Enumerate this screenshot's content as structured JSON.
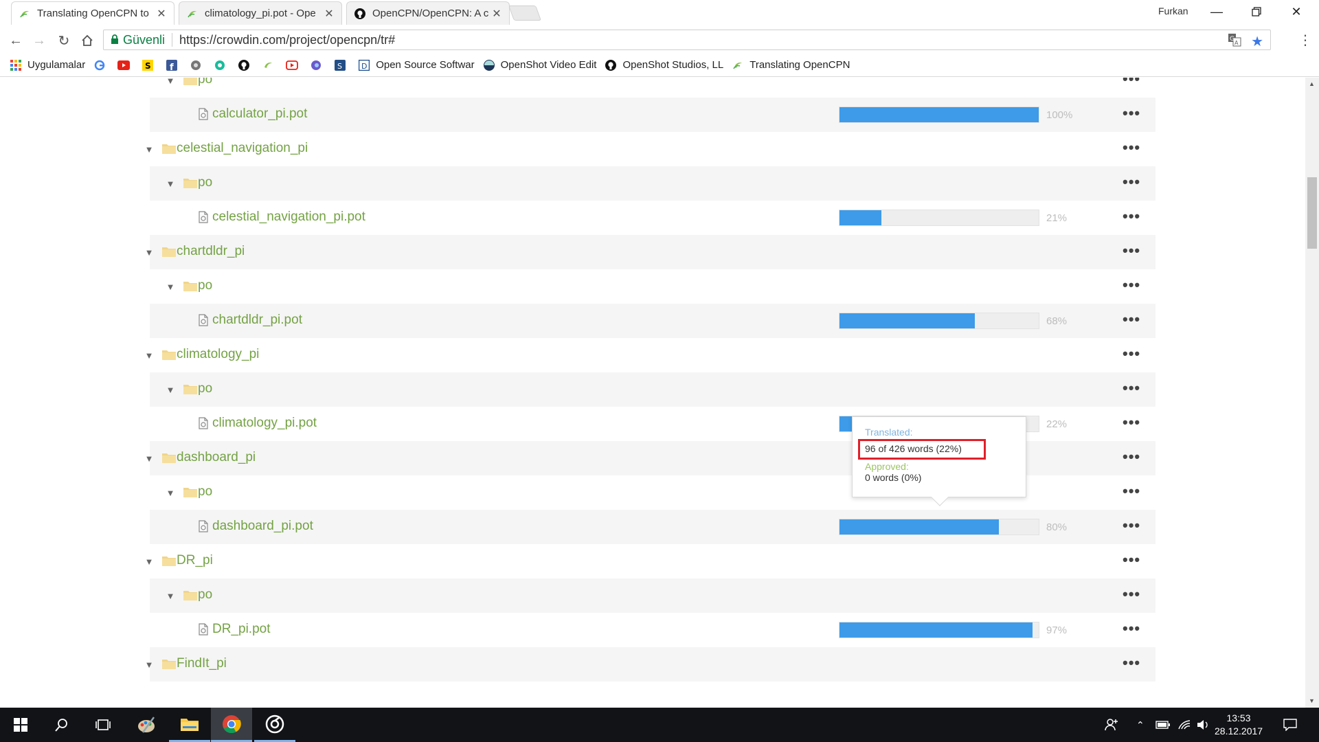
{
  "browser": {
    "tabs": [
      {
        "label": "Translating OpenCPN to",
        "active": true
      },
      {
        "label": "climatology_pi.pot - Ope",
        "active": false
      },
      {
        "label": "OpenCPN/OpenCPN: A c",
        "active": false
      }
    ],
    "user": "Furkan",
    "secure_label": "Güvenli",
    "url": "https://crowdin.com/project/opencpn/tr#"
  },
  "bookmarks": {
    "apps_label": "Uygulamalar",
    "labeled": [
      {
        "label": "Open Source Softwar"
      },
      {
        "label": "OpenShot Video Edit"
      },
      {
        "label": "OpenShot Studios, LL"
      },
      {
        "label": "Translating OpenCPN"
      }
    ]
  },
  "tree": [
    {
      "type": "subfolder",
      "name": "po"
    },
    {
      "type": "file",
      "name": "calculator_pi.pot",
      "progress": 100,
      "pct": "100%"
    },
    {
      "type": "folder",
      "name": "celestial_navigation_pi"
    },
    {
      "type": "subfolder",
      "name": "po"
    },
    {
      "type": "file",
      "name": "celestial_navigation_pi.pot",
      "progress": 21,
      "pct": "21%"
    },
    {
      "type": "folder",
      "name": "chartdldr_pi"
    },
    {
      "type": "subfolder",
      "name": "po"
    },
    {
      "type": "file",
      "name": "chartdldr_pi.pot",
      "progress": 68,
      "pct": "68%"
    },
    {
      "type": "folder",
      "name": "climatology_pi"
    },
    {
      "type": "subfolder",
      "name": "po"
    },
    {
      "type": "file",
      "name": "climatology_pi.pot",
      "progress": 22,
      "pct": "22%"
    },
    {
      "type": "folder",
      "name": "dashboard_pi"
    },
    {
      "type": "subfolder",
      "name": "po"
    },
    {
      "type": "file",
      "name": "dashboard_pi.pot",
      "progress": 80,
      "pct": "80%"
    },
    {
      "type": "folder",
      "name": "DR_pi"
    },
    {
      "type": "subfolder",
      "name": "po"
    },
    {
      "type": "file",
      "name": "DR_pi.pot",
      "progress": 97,
      "pct": "97%"
    },
    {
      "type": "folder",
      "name": "FindIt_pi"
    }
  ],
  "tooltip": {
    "translated_label": "Translated:",
    "translated_value": "96 of 426 words (22%)",
    "approved_label": "Approved:",
    "approved_value": "0 words (0%)"
  },
  "taskbar": {
    "time": "13:53",
    "date": "28.12.2017"
  },
  "colors": {
    "accent_green": "#74a244",
    "progress_blue": "#3d9be9",
    "highlight_red": "#e0202a"
  }
}
